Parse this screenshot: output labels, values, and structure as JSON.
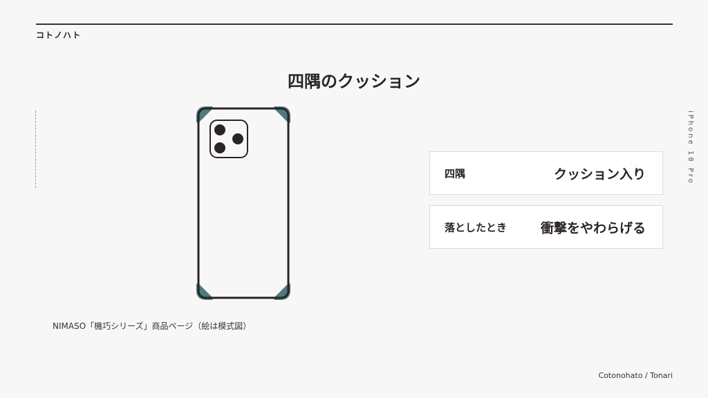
{
  "header": {
    "brand": "コトノハト"
  },
  "title": "四隅のクッション",
  "side_label": "iPhone 18 Pro",
  "cards": [
    {
      "label": "四隅",
      "value": "クッション入り"
    },
    {
      "label": "落としたとき",
      "value": "衝撃をやわらげる"
    }
  ],
  "caption": "NIMASO「機巧シリーズ」商品ページ（絵は模式図）",
  "footer": "Cotonohato / Tonari",
  "colors": {
    "corner_cushion": "#4d7a7c",
    "outline": "#2b2424",
    "background": "#f7f7f7"
  },
  "illustration": {
    "name": "phone-case-diagram",
    "camera_lenses": 3,
    "corner_cushions": 4
  }
}
